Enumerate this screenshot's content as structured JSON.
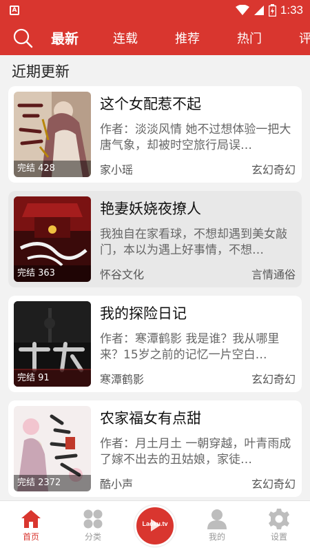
{
  "status_bar": {
    "time": "1:33",
    "icons": [
      "app-icon",
      "wifi-icon",
      "signal-icon",
      "battery-charging-icon"
    ]
  },
  "nav": {
    "tabs": [
      {
        "label": "最新",
        "active": true
      },
      {
        "label": "连载",
        "active": false
      },
      {
        "label": "推荐",
        "active": false
      },
      {
        "label": "热门",
        "active": false
      },
      {
        "label": "评",
        "active": false
      }
    ],
    "accent_color": "#d9362f"
  },
  "section_title": "近期更新",
  "books": [
    {
      "title": "这个女配惹不起",
      "desc": "作者：淡淡风情 她不过想体验一把大唐气象，却被时空旅行局误…",
      "author": "家小瑶",
      "genre": "玄幻奇幻",
      "badge": "完结 428",
      "highlighted": false
    },
    {
      "title": "艳妻妖娆夜撩人",
      "desc": "我独自在家看球，不想却遇到美女敲门，本以为遇上好事情，不想…",
      "author": "怀谷文化",
      "genre": "言情通俗",
      "badge": "完结 363",
      "highlighted": true
    },
    {
      "title": "我的探险日记",
      "desc": "作者：寒潭鹤影 我是谁？我从哪里来？15岁之前的记忆一片空白…",
      "author": "寒潭鹤影",
      "genre": "玄幻奇幻",
      "badge": "完结 91",
      "highlighted": false
    },
    {
      "title": "农家福女有点甜",
      "desc": "作者：月土月土 一朝穿越，叶青雨成了嫁不出去的丑姑娘，家徒…",
      "author": "酷小声",
      "genre": "玄幻奇幻",
      "badge": "完结 2372",
      "highlighted": false
    }
  ],
  "bottom_tabs": [
    {
      "label": "首页",
      "icon": "home-icon",
      "active": true
    },
    {
      "label": "分类",
      "icon": "category-grid-icon",
      "active": false
    },
    {
      "label": "我的",
      "icon": "user-icon",
      "active": false
    },
    {
      "label": "设置",
      "icon": "gear-icon",
      "active": false
    }
  ],
  "center_button": {
    "logo_text": "Laoku.tv",
    "icon": "play-icon"
  }
}
